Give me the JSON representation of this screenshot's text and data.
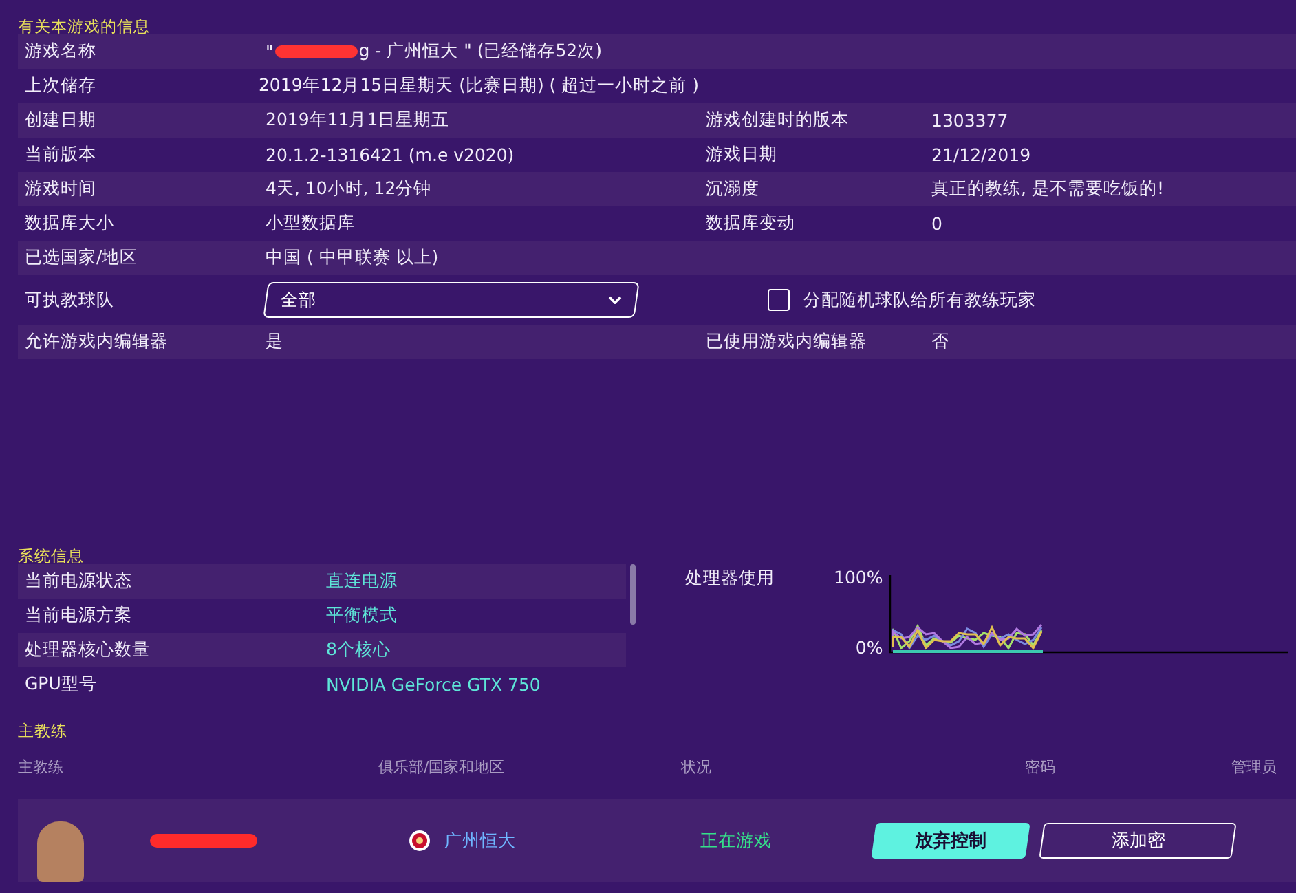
{
  "game_info": {
    "title": "有关本游戏的信息",
    "rows": [
      {
        "kind": "info",
        "items": [
          {
            "label": "游戏名称",
            "value": "\"",
            "redacted": true,
            "value_suffix": "g - 广州恒大 \" (已经储存52次)"
          }
        ]
      },
      {
        "kind": "info",
        "items": [
          {
            "label": "上次储存",
            "value": "2019年12月15日星期天 (比赛日期) ( 超过一小时之前 )"
          }
        ]
      },
      {
        "kind": "info",
        "items": [
          {
            "label": "创建日期",
            "value": "2019年11月1日星期五"
          },
          {
            "label": "游戏创建时的版本",
            "value": "1303377"
          }
        ]
      },
      {
        "kind": "info",
        "items": [
          {
            "label": "当前版本",
            "value": "20.1.2-1316421 (m.e v2020)"
          },
          {
            "label": "游戏日期",
            "value": "21/12/2019"
          }
        ]
      },
      {
        "kind": "info",
        "items": [
          {
            "label": "游戏时间",
            "value": "4天, 10小时, 12分钟"
          },
          {
            "label": "沉溺度",
            "value": "真正的教练, 是不需要吃饭的!"
          }
        ]
      },
      {
        "kind": "info",
        "items": [
          {
            "label": "数据库大小",
            "value": "小型数据库"
          },
          {
            "label": "数据库变动",
            "value": "0"
          }
        ]
      },
      {
        "kind": "info",
        "items": [
          {
            "label": "已选国家/地区",
            "value": "中国 ( 中甲联赛 以上)"
          }
        ]
      },
      {
        "kind": "control",
        "label": "可执教球队",
        "dropdown": {
          "value": "全部"
        },
        "checkbox": {
          "label": "分配随机球队给所有教练玩家",
          "checked": false
        }
      },
      {
        "kind": "info",
        "items": [
          {
            "label": "允许游戏内编辑器",
            "value": "是"
          },
          {
            "label": "已使用游戏内编辑器",
            "value": "否"
          }
        ]
      }
    ]
  },
  "system_info": {
    "title": "系统信息",
    "rows": [
      {
        "label": "当前电源状态",
        "value": "直连电源"
      },
      {
        "label": "当前电源方案",
        "value": "平衡模式"
      },
      {
        "label": "处理器核心数量",
        "value": "8个核心"
      },
      {
        "label": "GPU型号",
        "value": "NVIDIA GeForce GTX 750"
      }
    ],
    "cpu_usage": {
      "label": "处理器使用",
      "tick_high": "100%",
      "tick_low": "0%"
    }
  },
  "head_coach": {
    "title": "主教练",
    "columns": [
      "主教练",
      "俱乐部/国家和地区",
      "状况",
      "密码",
      "管理员"
    ],
    "rows": [
      {
        "redacted": true,
        "club": "广州恒大",
        "status": "正在游戏",
        "buttons": [
          {
            "label": "放弃控制",
            "kind": "primary"
          },
          {
            "label": "添加密",
            "kind": "outline"
          }
        ]
      }
    ]
  }
}
